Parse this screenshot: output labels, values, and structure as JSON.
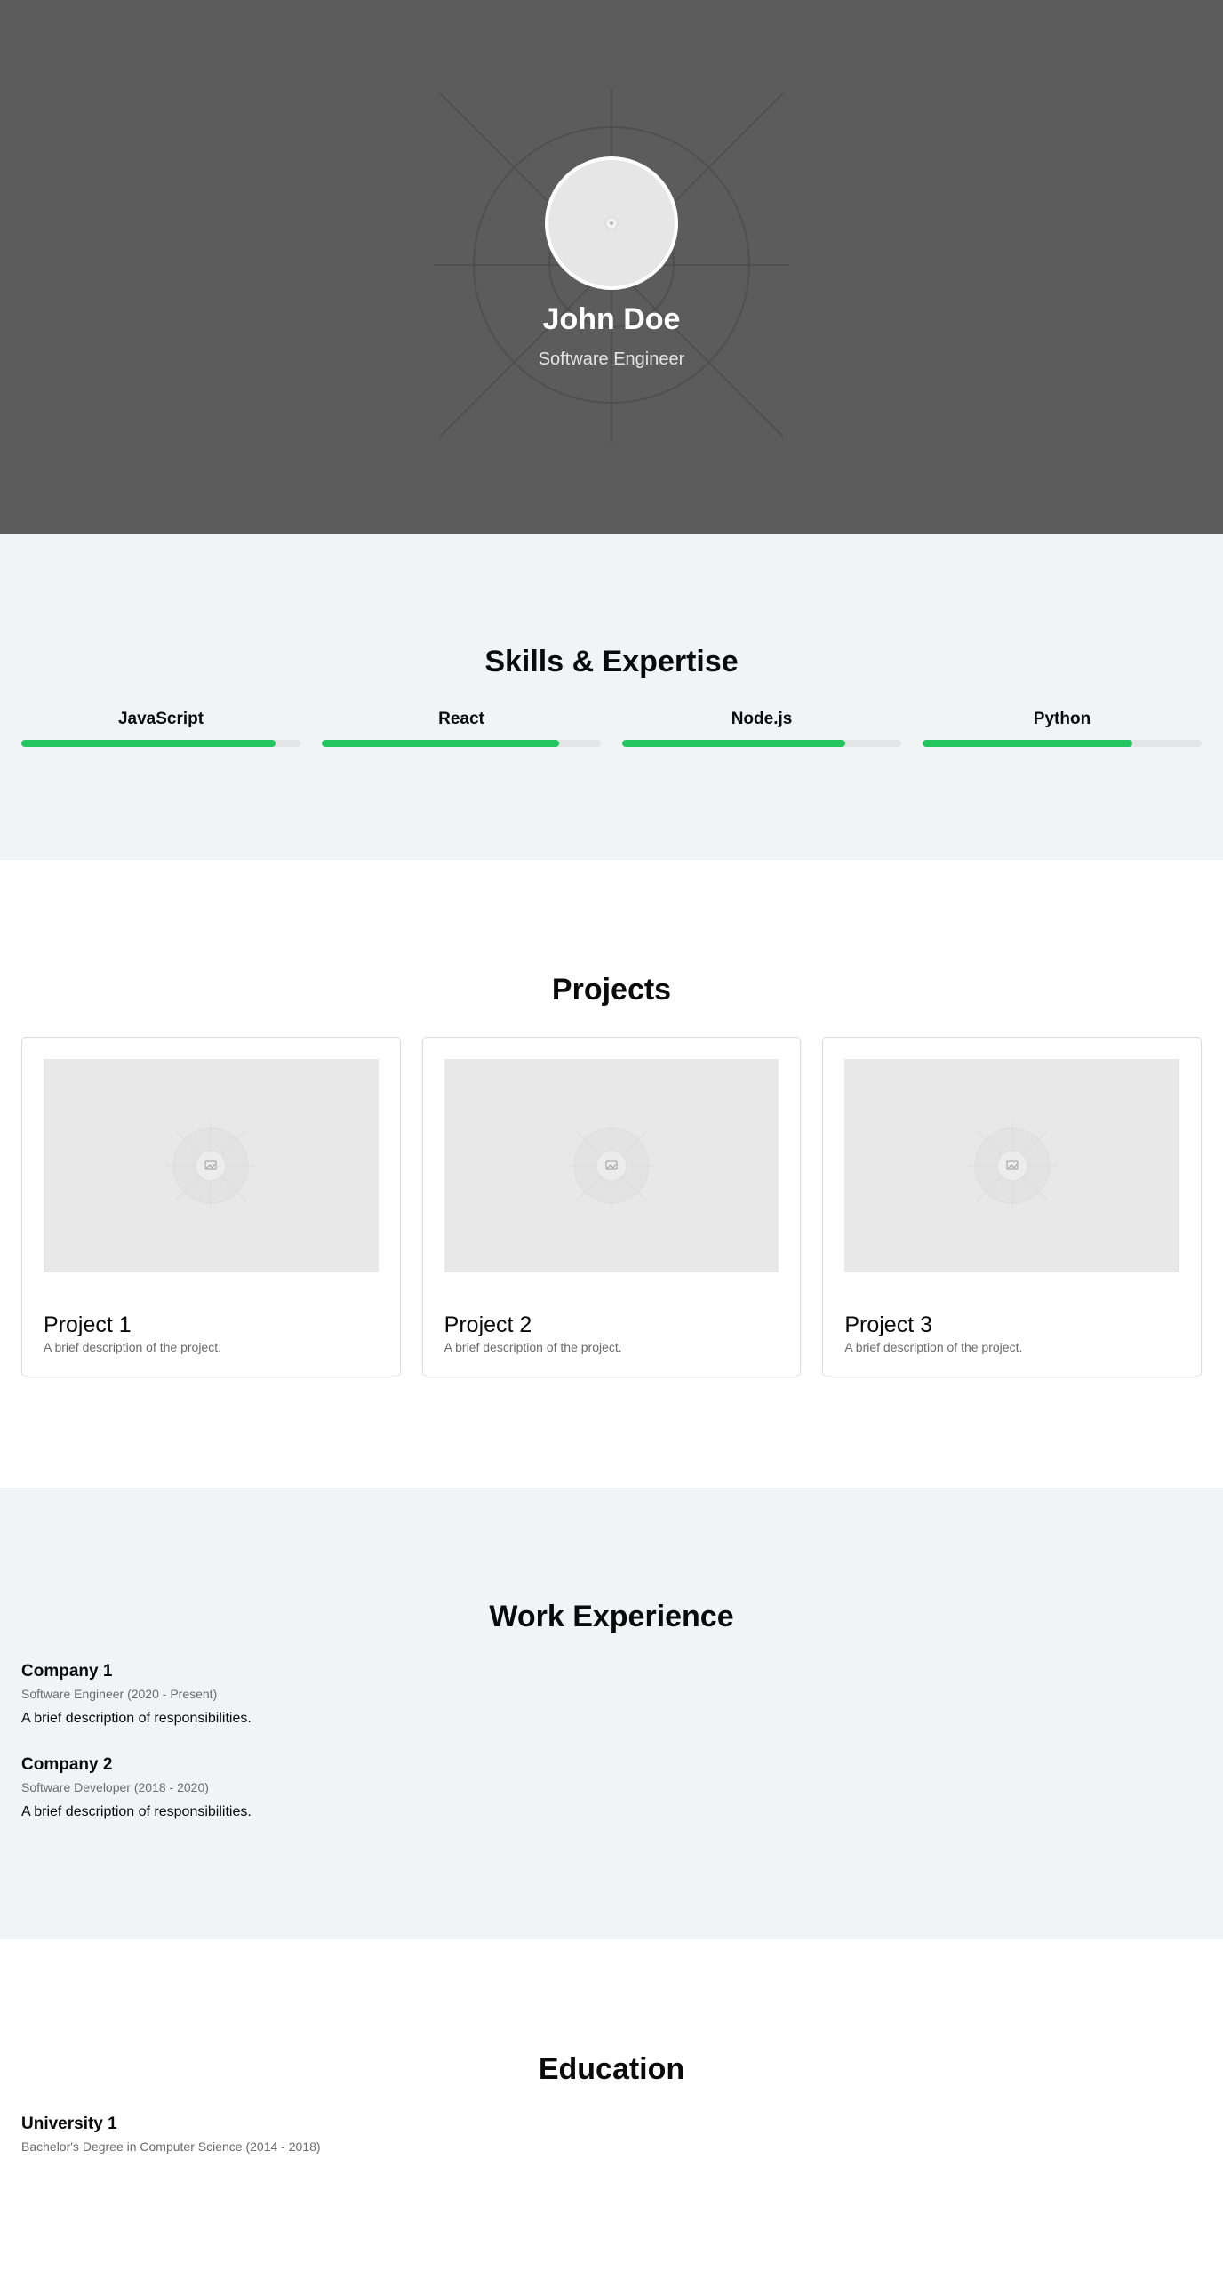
{
  "profile": {
    "name": "John Doe",
    "role": "Software Engineer",
    "avatar_icon": "image-placeholder-icon"
  },
  "skills": {
    "title": "Skills & Expertise",
    "items": [
      {
        "name": "JavaScript",
        "level": 0.91
      },
      {
        "name": "React",
        "level": 0.85
      },
      {
        "name": "Node.js",
        "level": 0.8
      },
      {
        "name": "Python",
        "level": 0.75
      }
    ],
    "bar_color": "#22c55e"
  },
  "projects": {
    "title": "Projects",
    "items": [
      {
        "title": "Project 1",
        "description": "A brief description of the project.",
        "image_icon": "image-placeholder-icon"
      },
      {
        "title": "Project 2",
        "description": "A brief description of the project.",
        "image_icon": "image-placeholder-icon"
      },
      {
        "title": "Project 3",
        "description": "A brief description of the project.",
        "image_icon": "image-placeholder-icon"
      }
    ]
  },
  "work": {
    "title": "Work Experience",
    "items": [
      {
        "company": "Company 1",
        "role": "Software Engineer (2020 - Present)",
        "description": "A brief description of responsibilities."
      },
      {
        "company": "Company 2",
        "role": "Software Developer (2018 - 2020)",
        "description": "A brief description of responsibilities."
      }
    ]
  },
  "education": {
    "title": "Education",
    "items": [
      {
        "school": "University 1",
        "degree": "Bachelor's Degree in Computer Science (2014 - 2018)"
      }
    ]
  },
  "colors": {
    "hero_bg": "#5c5c5c",
    "section_alt_bg": "#f2f3f5",
    "accent": "#22c55e"
  }
}
